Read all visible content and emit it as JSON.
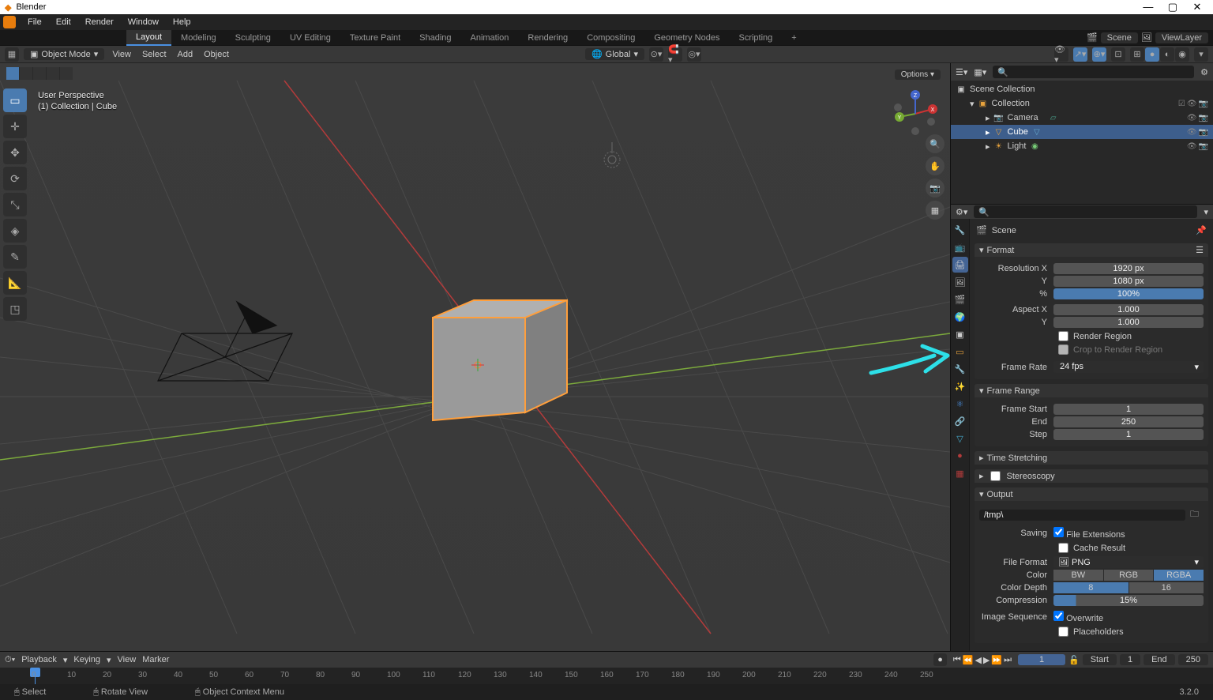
{
  "app": {
    "title": "Blender",
    "version": "3.2.0"
  },
  "win": {
    "min": "—",
    "max": "▢",
    "close": "✕"
  },
  "menus": [
    "File",
    "Edit",
    "Render",
    "Window",
    "Help"
  ],
  "workspaces": {
    "tabs": [
      "Layout",
      "Modeling",
      "Sculpting",
      "UV Editing",
      "Texture Paint",
      "Shading",
      "Animation",
      "Rendering",
      "Compositing",
      "Geometry Nodes",
      "Scripting"
    ],
    "active": "Layout",
    "scene": "Scene",
    "viewlayer": "ViewLayer"
  },
  "viewport": {
    "mode": "Object Mode",
    "menus": [
      "View",
      "Select",
      "Add",
      "Object"
    ],
    "orientation": "Global",
    "info_line1": "User Perspective",
    "info_line2": "(1) Collection | Cube",
    "options": "Options"
  },
  "tools": [
    "select",
    "cursor",
    "move",
    "rotate",
    "scale",
    "transform",
    "annotate",
    "measure",
    "add-cube"
  ],
  "outliner": {
    "root": "Scene Collection",
    "collection": "Collection",
    "items": [
      {
        "name": "Camera",
        "type": "camera"
      },
      {
        "name": "Cube",
        "type": "mesh",
        "selected": true
      },
      {
        "name": "Light",
        "type": "light"
      }
    ]
  },
  "properties": {
    "context": "Scene",
    "search_placeholder": "",
    "format": {
      "title": "Format",
      "res_x_label": "Resolution X",
      "res_x": "1920 px",
      "res_y_label": "Y",
      "res_y": "1080 px",
      "pct_label": "%",
      "pct": "100%",
      "aspect_x_label": "Aspect X",
      "aspect_x": "1.000",
      "aspect_y_label": "Y",
      "aspect_y": "1.000",
      "render_region": "Render Region",
      "crop": "Crop to Render Region",
      "framerate_label": "Frame Rate",
      "framerate": "24 fps"
    },
    "frame_range": {
      "title": "Frame Range",
      "start_label": "Frame Start",
      "start": "1",
      "end_label": "End",
      "end": "250",
      "step_label": "Step",
      "step": "1"
    },
    "time_stretching": "Time Stretching",
    "stereoscopy": "Stereoscopy",
    "output": {
      "title": "Output",
      "path": "/tmp\\",
      "saving_label": "Saving",
      "file_ext": "File Extensions",
      "cache_result": "Cache Result",
      "file_format_label": "File Format",
      "file_format": "PNG",
      "color_label": "Color",
      "color_bw": "BW",
      "color_rgb": "RGB",
      "color_rgba": "RGBA",
      "depth_label": "Color Depth",
      "depth_8": "8",
      "depth_16": "16",
      "compression_label": "Compression",
      "compression": "15%",
      "seq_label": "Image Sequence",
      "overwrite": "Overwrite",
      "placeholders": "Placeholders"
    }
  },
  "timeline": {
    "menus": [
      "Playback",
      "Keying",
      "View",
      "Marker"
    ],
    "current": "1",
    "start_label": "Start",
    "start": "1",
    "end_label": "End",
    "end": "250",
    "ticks": [
      "0",
      "10",
      "20",
      "30",
      "40",
      "50",
      "60",
      "70",
      "80",
      "90",
      "100",
      "110",
      "120",
      "130",
      "140",
      "150",
      "160",
      "170",
      "180",
      "190",
      "200",
      "210",
      "220",
      "230",
      "240",
      "250"
    ]
  },
  "status": {
    "select": "Select",
    "rotate": "Rotate View",
    "context": "Object Context Menu"
  }
}
